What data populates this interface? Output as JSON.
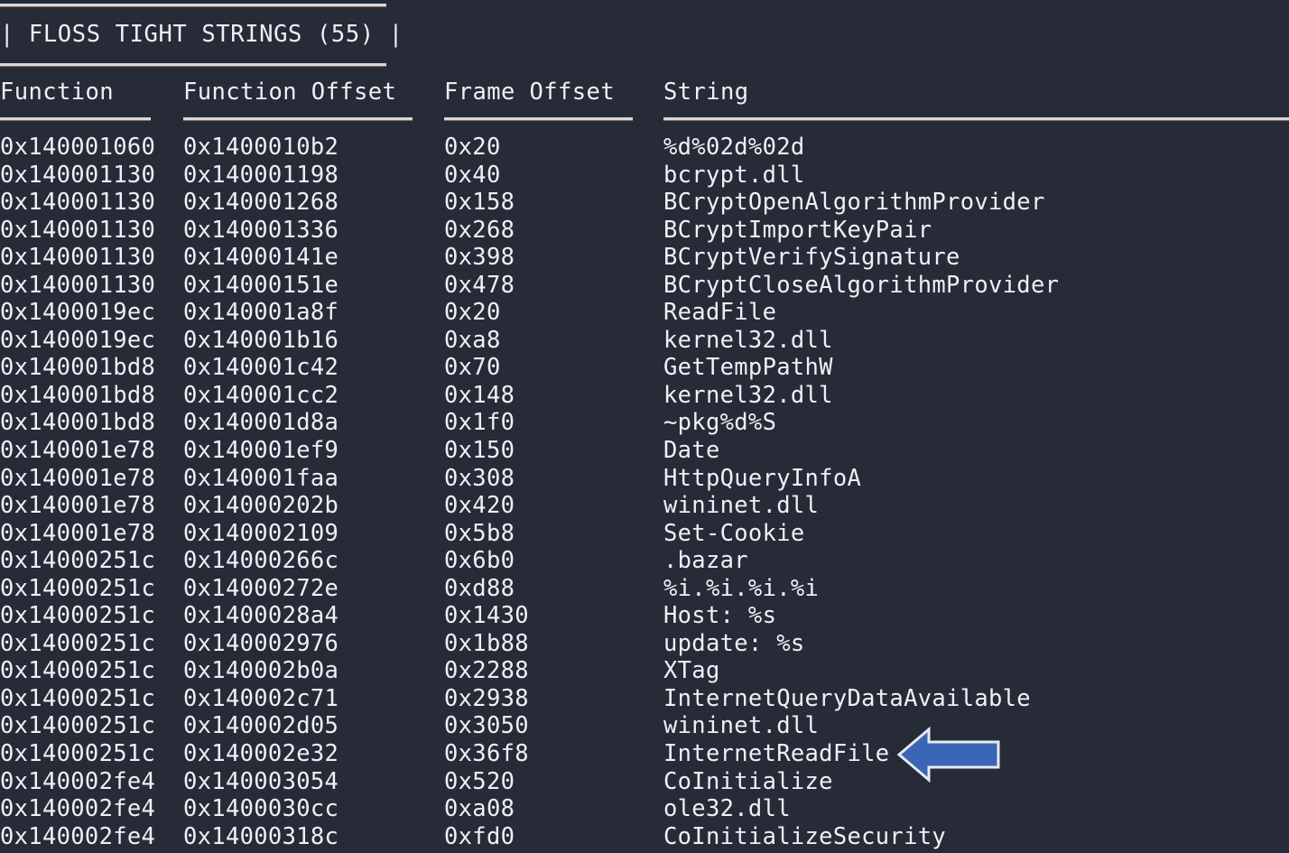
{
  "panel": {
    "title": "| FLOSS TIGHT STRINGS (55) |",
    "string_count": 55,
    "colors": {
      "background": "#272b38",
      "text": "#eef0f4",
      "rule": "#d5d8de",
      "rule_shadow": "#e2a05a",
      "arrow_fill": "#3a66b5",
      "arrow_outline": "#e6eaf2"
    }
  },
  "table": {
    "columns": [
      {
        "key": "function",
        "label": "Function"
      },
      {
        "key": "function_offset",
        "label": "Function Offset"
      },
      {
        "key": "frame_offset",
        "label": "Frame Offset"
      },
      {
        "key": "string",
        "label": "String"
      }
    ],
    "rows": [
      {
        "function": "0x140001060",
        "function_offset": "0x1400010b2",
        "frame_offset": "0x20",
        "string": "%d%02d%02d"
      },
      {
        "function": "0x140001130",
        "function_offset": "0x140001198",
        "frame_offset": "0x40",
        "string": "bcrypt.dll"
      },
      {
        "function": "0x140001130",
        "function_offset": "0x140001268",
        "frame_offset": "0x158",
        "string": "BCryptOpenAlgorithmProvider"
      },
      {
        "function": "0x140001130",
        "function_offset": "0x140001336",
        "frame_offset": "0x268",
        "string": "BCryptImportKeyPair"
      },
      {
        "function": "0x140001130",
        "function_offset": "0x14000141e",
        "frame_offset": "0x398",
        "string": "BCryptVerifySignature"
      },
      {
        "function": "0x140001130",
        "function_offset": "0x14000151e",
        "frame_offset": "0x478",
        "string": "BCryptCloseAlgorithmProvider"
      },
      {
        "function": "0x1400019ec",
        "function_offset": "0x140001a8f",
        "frame_offset": "0x20",
        "string": "ReadFile"
      },
      {
        "function": "0x1400019ec",
        "function_offset": "0x140001b16",
        "frame_offset": "0xa8",
        "string": "kernel32.dll"
      },
      {
        "function": "0x140001bd8",
        "function_offset": "0x140001c42",
        "frame_offset": "0x70",
        "string": "GetTempPathW"
      },
      {
        "function": "0x140001bd8",
        "function_offset": "0x140001cc2",
        "frame_offset": "0x148",
        "string": "kernel32.dll"
      },
      {
        "function": "0x140001bd8",
        "function_offset": "0x140001d8a",
        "frame_offset": "0x1f0",
        "string": "~pkg%d%S"
      },
      {
        "function": "0x140001e78",
        "function_offset": "0x140001ef9",
        "frame_offset": "0x150",
        "string": "Date"
      },
      {
        "function": "0x140001e78",
        "function_offset": "0x140001faa",
        "frame_offset": "0x308",
        "string": "HttpQueryInfoA"
      },
      {
        "function": "0x140001e78",
        "function_offset": "0x14000202b",
        "frame_offset": "0x420",
        "string": "wininet.dll"
      },
      {
        "function": "0x140001e78",
        "function_offset": "0x140002109",
        "frame_offset": "0x5b8",
        "string": "Set-Cookie"
      },
      {
        "function": "0x14000251c",
        "function_offset": "0x14000266c",
        "frame_offset": "0x6b0",
        "string": ".bazar"
      },
      {
        "function": "0x14000251c",
        "function_offset": "0x14000272e",
        "frame_offset": "0xd88",
        "string": "%i.%i.%i.%i"
      },
      {
        "function": "0x14000251c",
        "function_offset": "0x1400028a4",
        "frame_offset": "0x1430",
        "string": "Host: %s"
      },
      {
        "function": "0x14000251c",
        "function_offset": "0x140002976",
        "frame_offset": "0x1b88",
        "string": "update: %s"
      },
      {
        "function": "0x14000251c",
        "function_offset": "0x140002b0a",
        "frame_offset": "0x2288",
        "string": "XTag"
      },
      {
        "function": "0x14000251c",
        "function_offset": "0x140002c71",
        "frame_offset": "0x2938",
        "string": "InternetQueryDataAvailable"
      },
      {
        "function": "0x14000251c",
        "function_offset": "0x140002d05",
        "frame_offset": "0x3050",
        "string": "wininet.dll"
      },
      {
        "function": "0x14000251c",
        "function_offset": "0x140002e32",
        "frame_offset": "0x36f8",
        "string": "InternetReadFile"
      },
      {
        "function": "0x140002fe4",
        "function_offset": "0x140003054",
        "frame_offset": "0x520",
        "string": "CoInitialize"
      },
      {
        "function": "0x140002fe4",
        "function_offset": "0x1400030cc",
        "frame_offset": "0xa08",
        "string": "ole32.dll"
      },
      {
        "function": "0x140002fe4",
        "function_offset": "0x14000318c",
        "frame_offset": "0xfd0",
        "string": "CoInitializeSecurity"
      }
    ]
  },
  "annotation": {
    "icon": "arrow-left-icon",
    "points_to_row_index": 22,
    "points_to_value": "InternetReadFile"
  }
}
